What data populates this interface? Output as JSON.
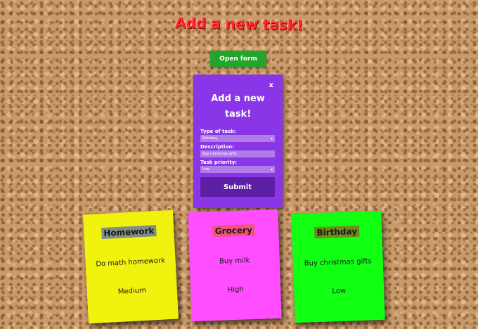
{
  "header": {
    "title": "Add a new task!"
  },
  "open_form_button": {
    "label": "Open form"
  },
  "modal": {
    "close_label": "x",
    "title": "Add a new task!",
    "type_label": "Type of task:",
    "type_value": "Birthday",
    "description_label": "Description:",
    "description_value": "Buy Christmas gifts",
    "priority_label": "Task priority:",
    "priority_value": "Low",
    "submit_label": "Submit"
  },
  "notes": [
    {
      "title": "Homework",
      "description": "Do math homework",
      "priority": "Medium",
      "color": "#f2f20f"
    },
    {
      "title": "Grocery",
      "description": "Buy milk",
      "priority": "High",
      "color": "#ff4dff"
    },
    {
      "title": "Birthday",
      "description": "Buy christmas gifts",
      "priority": "Low",
      "color": "#11ff11"
    }
  ]
}
